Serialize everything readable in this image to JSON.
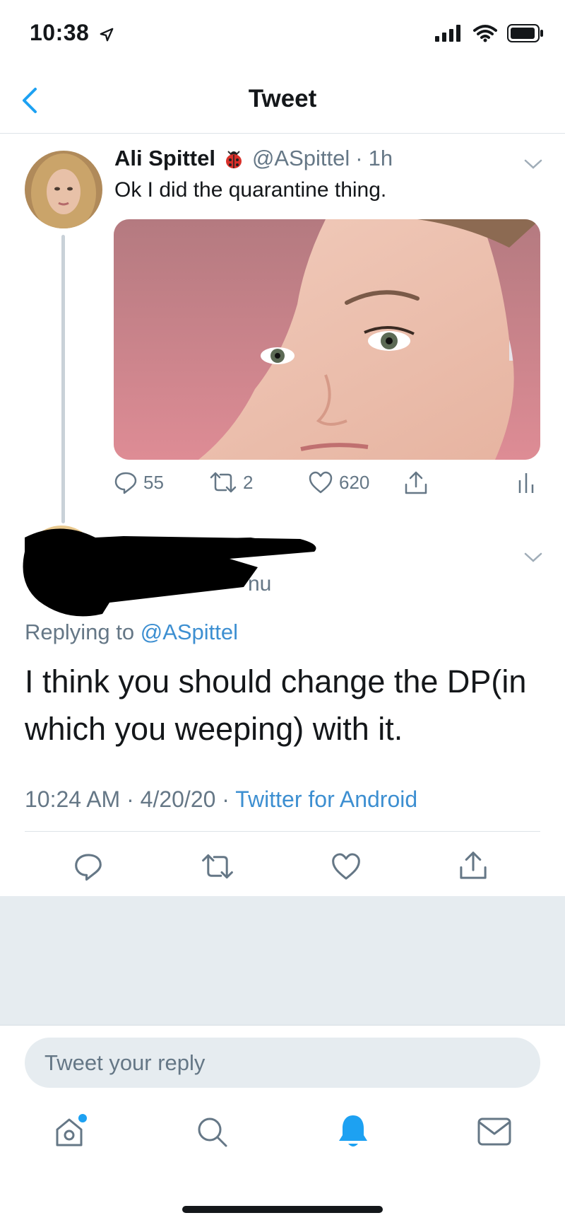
{
  "status_bar": {
    "time": "10:38"
  },
  "nav": {
    "title": "Tweet"
  },
  "tweet": {
    "author_name": "Ali Spittel",
    "handle": "@ASpittel",
    "separator": "·",
    "time_ago": "1h",
    "text": "Ok I did the quarantine thing.",
    "replies": "55",
    "retweets": "2",
    "likes": "620"
  },
  "reply": {
    "handle_fragment": "nu",
    "replying_prefix": "Replying to",
    "replying_to": "@ASpittel",
    "text": "I think you should change the DP(in which you weeping) with it.",
    "time": "10:24 AM",
    "date": "4/20/20",
    "separator": "·",
    "source": "Twitter for Android"
  },
  "composer": {
    "placeholder": "Tweet your reply"
  },
  "colors": {
    "accent": "#1DA1F2",
    "link": "#3D8FD1",
    "secondary_text": "#657786",
    "band": "#E6ECF0"
  }
}
